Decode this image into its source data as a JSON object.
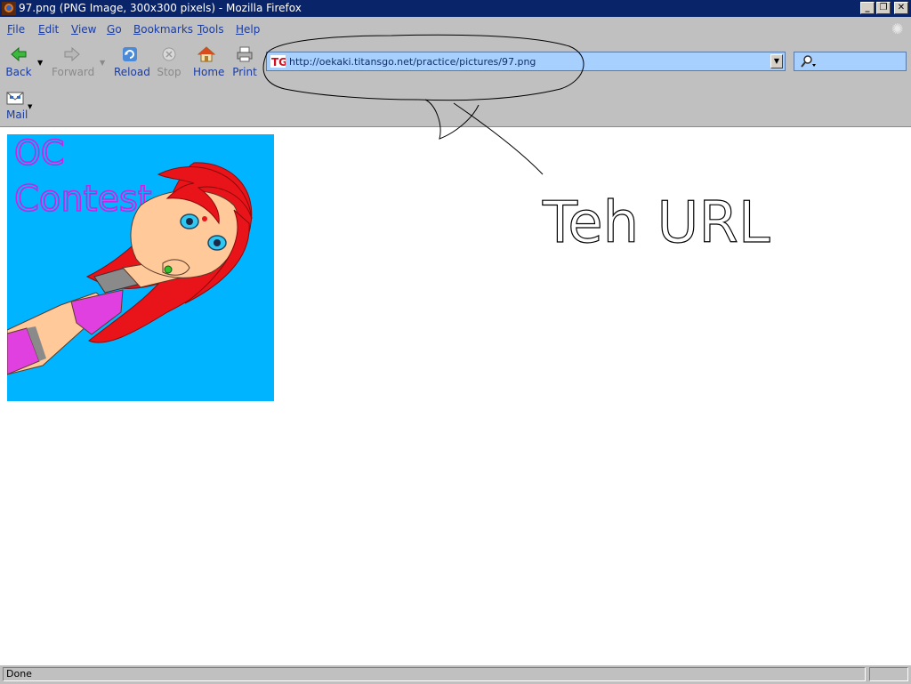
{
  "window": {
    "title": "97.png (PNG Image, 300x300 pixels) - Mozilla Firefox"
  },
  "menu": {
    "items": [
      {
        "label": "File",
        "accel": "F",
        "rest": "ile"
      },
      {
        "label": "Edit",
        "accel": "E",
        "rest": "dit"
      },
      {
        "label": "View",
        "accel": "V",
        "rest": "iew"
      },
      {
        "label": "Go",
        "accel": "G",
        "rest": "o"
      },
      {
        "label": "Bookmarks",
        "accel": "B",
        "rest": "ookmarks"
      },
      {
        "label": "Tools",
        "accel": "T",
        "rest": "ools"
      },
      {
        "label": "Help",
        "accel": "H",
        "rest": "elp"
      }
    ]
  },
  "toolbar": {
    "back_label": "Back",
    "forward_label": "Forward",
    "reload_label": "Reload",
    "stop_label": "Stop",
    "home_label": "Home",
    "print_label": "Print"
  },
  "address": {
    "url": "http://oekaki.titansgo.net/practice/pictures/97.png",
    "favicon_text": "TG"
  },
  "personal": {
    "mail_label": "Mail"
  },
  "content": {
    "image_caption_line1": "OC",
    "image_caption_line2": "Contest",
    "annotation_text": "Teh URL"
  },
  "status": {
    "text": "Done"
  },
  "colors": {
    "titlebar": "#0a246a",
    "chrome": "#c0c0c0",
    "urlbar": "#a8d0ff",
    "link_blue": "#1a3ca0",
    "image_bg": "#00b4ff",
    "hair": "#e8141a",
    "caption": "#d020e0"
  }
}
